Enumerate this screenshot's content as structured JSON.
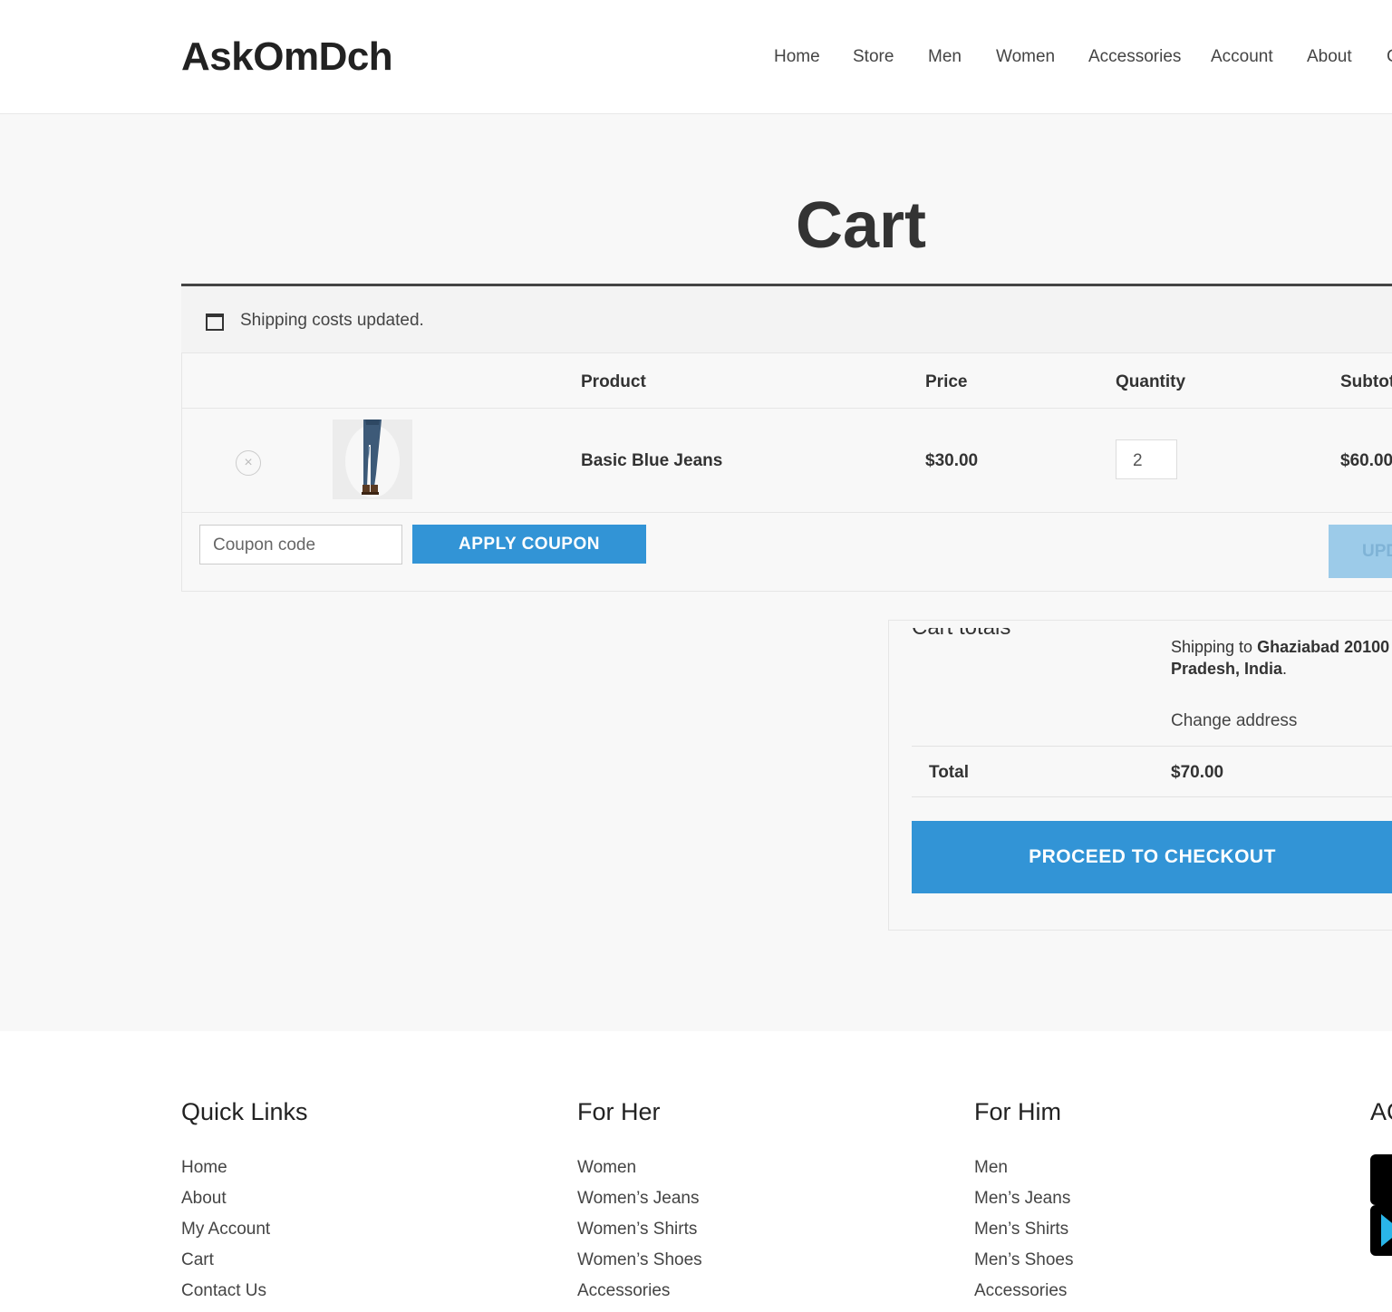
{
  "header": {
    "logo": "AskOmDch",
    "nav": [
      "Home",
      "Store",
      "Men",
      "Women",
      "Accessories",
      "Account",
      "About",
      "C"
    ]
  },
  "page": {
    "title": "Cart"
  },
  "notice": {
    "text": "Shipping costs updated."
  },
  "cart": {
    "columns": {
      "product": "Product",
      "price": "Price",
      "quantity": "Quantity",
      "subtotal": "Subtot"
    },
    "items": [
      {
        "remove_icon": "×",
        "name": "Basic Blue Jeans",
        "price": "$30.00",
        "quantity": "2",
        "subtotal": "$60.00"
      }
    ],
    "coupon_placeholder": "Coupon code",
    "apply_coupon": "APPLY COUPON",
    "update_cart": "UPD"
  },
  "totals": {
    "heading": "Cart totals",
    "shipping_prefix": "Shipping to ",
    "shipping_place": "Ghaziabad 20100",
    "shipping_place_2": "Pradesh, India",
    "shipping_suffix": ".",
    "change_address": "Change address",
    "total_label": "Total",
    "total_value": "$70.00",
    "checkout": "PROCEED TO CHECKOUT"
  },
  "footer": {
    "quick_links": {
      "title": "Quick Links",
      "items": [
        "Home",
        "About",
        "My Account",
        "Cart",
        "Contact Us"
      ]
    },
    "for_her": {
      "title": "For Her",
      "items": [
        "Women",
        "Women’s Jeans",
        "Women’s Shirts",
        "Women’s Shoes",
        "Accessories"
      ]
    },
    "for_him": {
      "title": "For Him",
      "items": [
        "Men",
        "Men’s Jeans",
        "Men’s Shirts",
        "Men’s Shoes",
        "Accessories"
      ]
    },
    "apps_title": "AC"
  },
  "colors": {
    "accent": "#3294d6",
    "accent_disabled": "#9ccbe9",
    "background": "#f8f8f8"
  },
  "icons": [
    "calendar-icon",
    "remove-icon",
    "apple-store-icon",
    "google-play-icon"
  ]
}
